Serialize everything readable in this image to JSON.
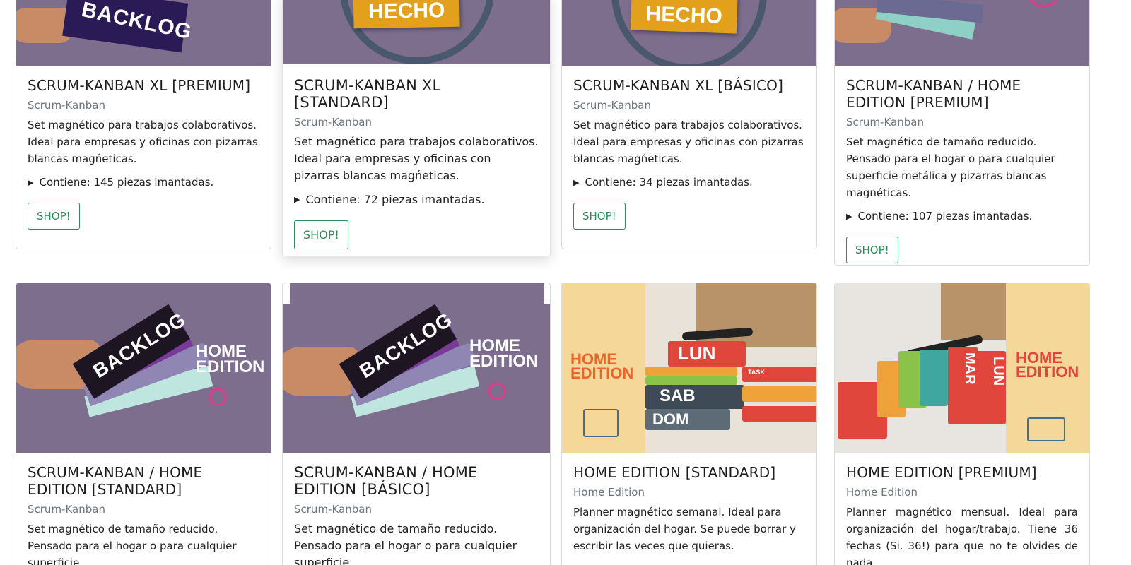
{
  "shop_label": "SHOP!",
  "colors": {
    "accent": "#2e8b57",
    "image_bg": "#7d6e8e",
    "note": "#e3a01c"
  },
  "cards": [
    {
      "title": "SCRUM-KANBAN XL [PREMIUM]",
      "category": "Scrum-Kanban",
      "description": "Set magnético para trabajos colaborativos. Ideal para empresas y oficinas con pizarras blancas magńeticas.",
      "contents": "Contiene: 145 piezas imantadas.",
      "image_text": "BACKLOG"
    },
    {
      "title": "SCRUM-KANBAN XL [STANDARD]",
      "category": "Scrum-Kanban",
      "description": "Set magnético para trabajos colaborativos. Ideal para empresas y oficinas con pizarras blancas magńeticas.",
      "contents": "Contiene: 72 piezas imantadas.",
      "image_text": "HECHO"
    },
    {
      "title": "SCRUM-KANBAN XL [BÁSICO]",
      "category": "Scrum-Kanban",
      "description": "Set magnético para trabajos colaborativos. Ideal para empresas y oficinas con pizarras blancas magńeticas.",
      "contents": "Contiene: 34 piezas imantadas.",
      "image_text": "HECHO"
    },
    {
      "title": "SCRUM-KANBAN / HOME EDITION [PREMIUM]",
      "category": "Scrum-Kanban",
      "description": "Set magnético de tamaño reducido. Pensado para el hogar o para cualquier superficie metálica y pizarras blancas magnéticas.",
      "contents": "Contiene: 107 piezas imantadas."
    },
    {
      "title": "SCRUM-KANBAN / HOME EDITION [STANDARD]",
      "category": "Scrum-Kanban",
      "description": "Set magnético de tamaño reducido. Pensado para el hogar o para cualquier superficie",
      "image_text": "BACKLOG",
      "image_badge_1": "HOME",
      "image_badge_2": "EDITION"
    },
    {
      "title": "SCRUM-KANBAN / HOME EDITION [BÁSICO]",
      "category": "Scrum-Kanban",
      "description": "Set magnético de tamaño reducido. Pensado para el hogar o para cualquier superficie",
      "image_text": "BACKLOG",
      "image_badge_1": "HOME",
      "image_badge_2": "EDITION"
    },
    {
      "title": "HOME EDITION [STANDARD]",
      "category": "Home Edition",
      "description": "Planner magnético semanal. Ideal para organización del hogar. Se puede borrar y escribir las veces que quieras.",
      "image_badge_1": "HOME",
      "image_badge_2": "EDITION",
      "image_days": [
        "LUN",
        "SAB",
        "DOM"
      ],
      "image_task": "TASK"
    },
    {
      "title": "HOME EDITION [PREMIUM]",
      "category": "Home Edition",
      "description": "Planner magnético mensual. Ideal para organización del hogar/trabajo. Tiene 36 fechas (Si. 36!) para que no te olvides de nada.",
      "image_badge_1": "HOME",
      "image_badge_2": "EDITION",
      "image_days": [
        "LUN",
        "MAR"
      ]
    }
  ]
}
